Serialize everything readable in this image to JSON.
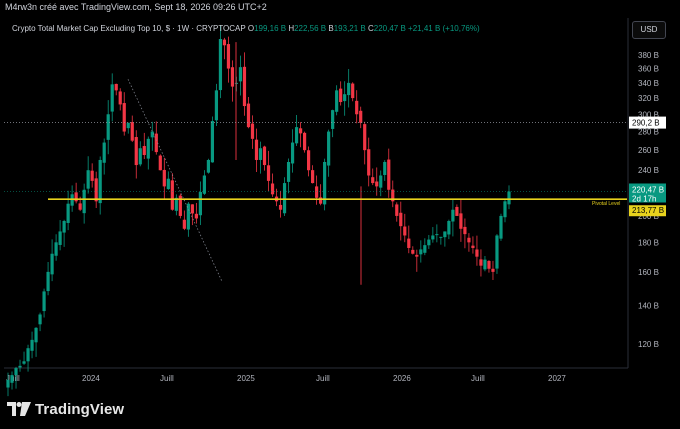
{
  "header": {
    "attribution": "M4rw3n créé avec TradingView.com, Sept 18, 2026 09:26 UTC+2"
  },
  "legend": {
    "symbol": "Crypto Total Market Cap Excluding Top 10, $ · 1W · CRYPTOCAP",
    "open_label": "O",
    "open": "199,16 B",
    "high_label": "H",
    "high": "222,56 B",
    "low_label": "B",
    "low": "193,21 B",
    "close_label": "C",
    "close": "220,47 B",
    "change": "+21,41 B (+10,76%)"
  },
  "currency_button": "USD",
  "brand": {
    "name": "TradingView",
    "logo_icon": "tradingview-logo-icon"
  },
  "colors": {
    "up": "#089981",
    "down": "#f23645",
    "pivot": "#e8d21d",
    "background": "#000000"
  },
  "chart_data": {
    "type": "candlestick",
    "interval": "1W",
    "y_scale": "log",
    "y_ticks": [
      "120 B",
      "140 B",
      "160 B",
      "180 B",
      "200 B",
      "220 B",
      "240 B",
      "260 B",
      "280 B",
      "300 B",
      "320 B",
      "340 B",
      "360 B",
      "380 B"
    ],
    "y_tick_values": [
      120,
      140,
      160,
      180,
      200,
      220,
      240,
      260,
      280,
      300,
      320,
      340,
      360,
      380
    ],
    "x_ticks": [
      "Juill",
      "2024",
      "Juill",
      "2025",
      "Juill",
      "2026",
      "Juill",
      "2027"
    ],
    "price_labels": {
      "dotted_level": "290,2 B",
      "last_price": "220,47 B",
      "countdown": "2d 17h",
      "pivot_price": "213,77 B"
    },
    "dotted_level_value": 290.2,
    "last_price_value": 220.47,
    "pivot_value": 213.77,
    "pivot_label": "Pivotal Level",
    "close_path_weekly": [
      [
        104,
        106,
        109,
        110,
        112,
        118,
        122,
        128,
        135,
        148,
        160,
        172,
        180,
        188,
        196,
        210,
        218,
        212,
        205,
        222,
        240,
        230,
        212,
        250,
        268,
        300,
        338,
        330,
        312,
        280,
        290,
        270,
        245,
        262,
        255,
        272,
        280,
        258,
        240,
        225,
        232,
        205,
        215,
        200,
        190,
        210,
        202,
        198,
        220,
        235,
        250,
        292,
        330,
        405,
        395,
        360,
        335,
        340,
        362,
        310,
        285,
        272,
        250,
        262,
        245,
        230,
        218,
        212,
        205,
        228,
        248,
        268,
        285,
        278,
        260,
        240,
        228,
        215,
        210,
        248,
        280,
        305,
        330,
        315,
        325,
        340,
        320,
        300,
        290,
        260,
        235,
        228,
        225,
        235,
        248,
        222,
        212,
        200,
        192,
        185,
        176,
        172,
        170,
        175,
        178,
        182,
        185,
        186,
        184,
        188,
        196,
        205,
        200,
        190,
        186,
        180,
        176,
        170,
        164,
        168,
        162,
        160,
        185,
        200,
        212,
        220.47
      ]
    ]
  }
}
